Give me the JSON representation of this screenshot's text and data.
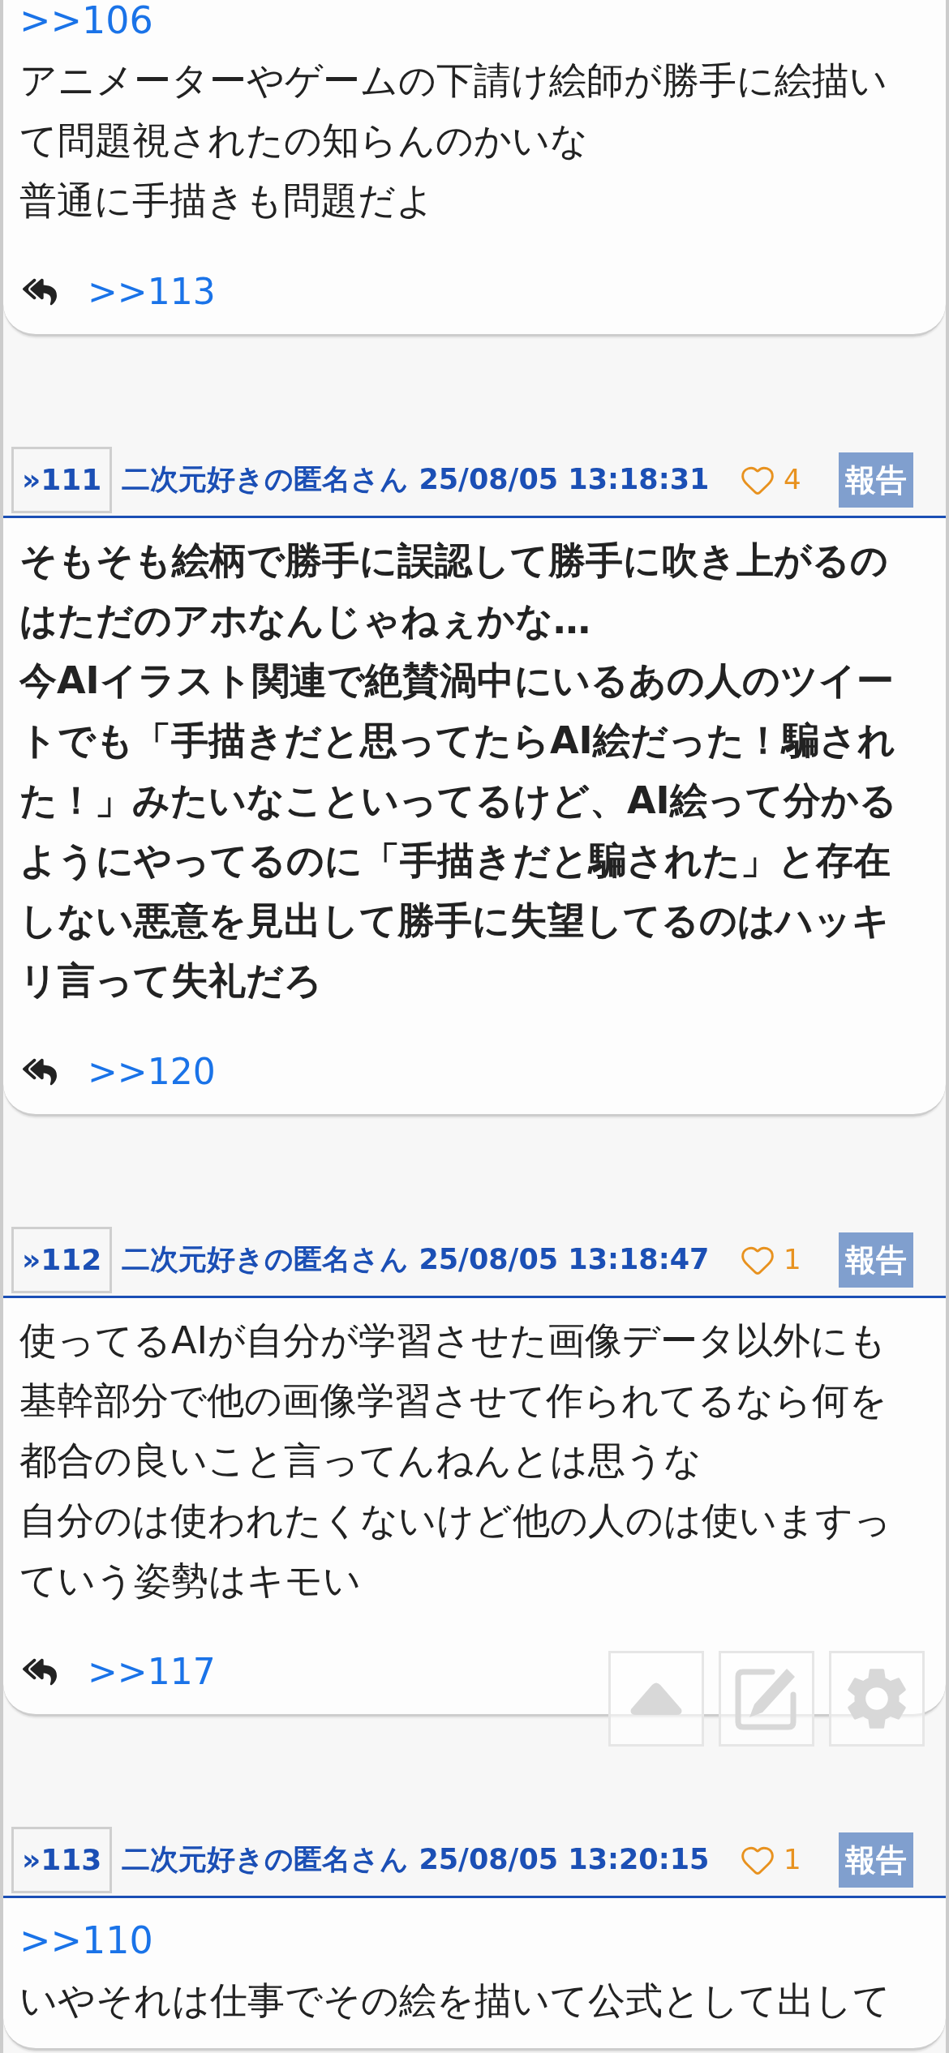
{
  "posts": [
    {
      "body": [
        {
          "kind": "quote",
          "text": ">>106"
        },
        {
          "kind": "text",
          "text": "アニメーターやゲームの下請け絵師が勝手に絵描いて問題視されたの知らんのかいな"
        },
        {
          "kind": "text",
          "text": "普通に手描きも問題だよ"
        }
      ],
      "bold": false,
      "replies": [
        ">>113"
      ]
    },
    {
      "header": {
        "number": "»111",
        "name": "二次元好きの匿名さん",
        "date": "25/08/05 13:18:31",
        "likes": "4",
        "report": "報告"
      },
      "body": [
        {
          "kind": "text",
          "text": "そもそも絵柄で勝手に誤認して勝手に吹き上がるのはただのアホなんじゃねぇかな…"
        },
        {
          "kind": "text",
          "text": "今AIイラスト関連で絶賛渦中にいるあの人のツイートでも「手描きだと思ってたらAI絵だった！騙された！」みたいなこといってるけど、AI絵って分かるようにやってるのに「手描きだと騙された」と存在しない悪意を見出して勝手に失望してるのはハッキリ言って失礼だろ"
        }
      ],
      "bold": true,
      "replies": [
        ">>120"
      ]
    },
    {
      "header": {
        "number": "»112",
        "name": "二次元好きの匿名さん",
        "date": "25/08/05 13:18:47",
        "likes": "1",
        "report": "報告"
      },
      "body": [
        {
          "kind": "text",
          "text": "使ってるAIが自分が学習させた画像データ以外にも基幹部分で他の画像学習させて作られてるなら何を都合の良いこと言ってんねんとは思うな"
        },
        {
          "kind": "text",
          "text": "自分のは使われたくないけど他の人のは使いますっていう姿勢はキモい"
        }
      ],
      "bold": false,
      "replies": [
        ">>117"
      ]
    },
    {
      "header": {
        "number": "»113",
        "name": "二次元好きの匿名さん",
        "date": "25/08/05 13:20:15",
        "likes": "1",
        "report": "報告"
      },
      "body": [
        {
          "kind": "quote",
          "text": ">>110"
        },
        {
          "kind": "text",
          "text": "いやそれは仕事でその絵を描いて公式として出して"
        }
      ],
      "bold": false
    }
  ],
  "floating_buttons": [
    {
      "kind": "top"
    },
    {
      "kind": "write"
    },
    {
      "kind": "settings"
    }
  ]
}
